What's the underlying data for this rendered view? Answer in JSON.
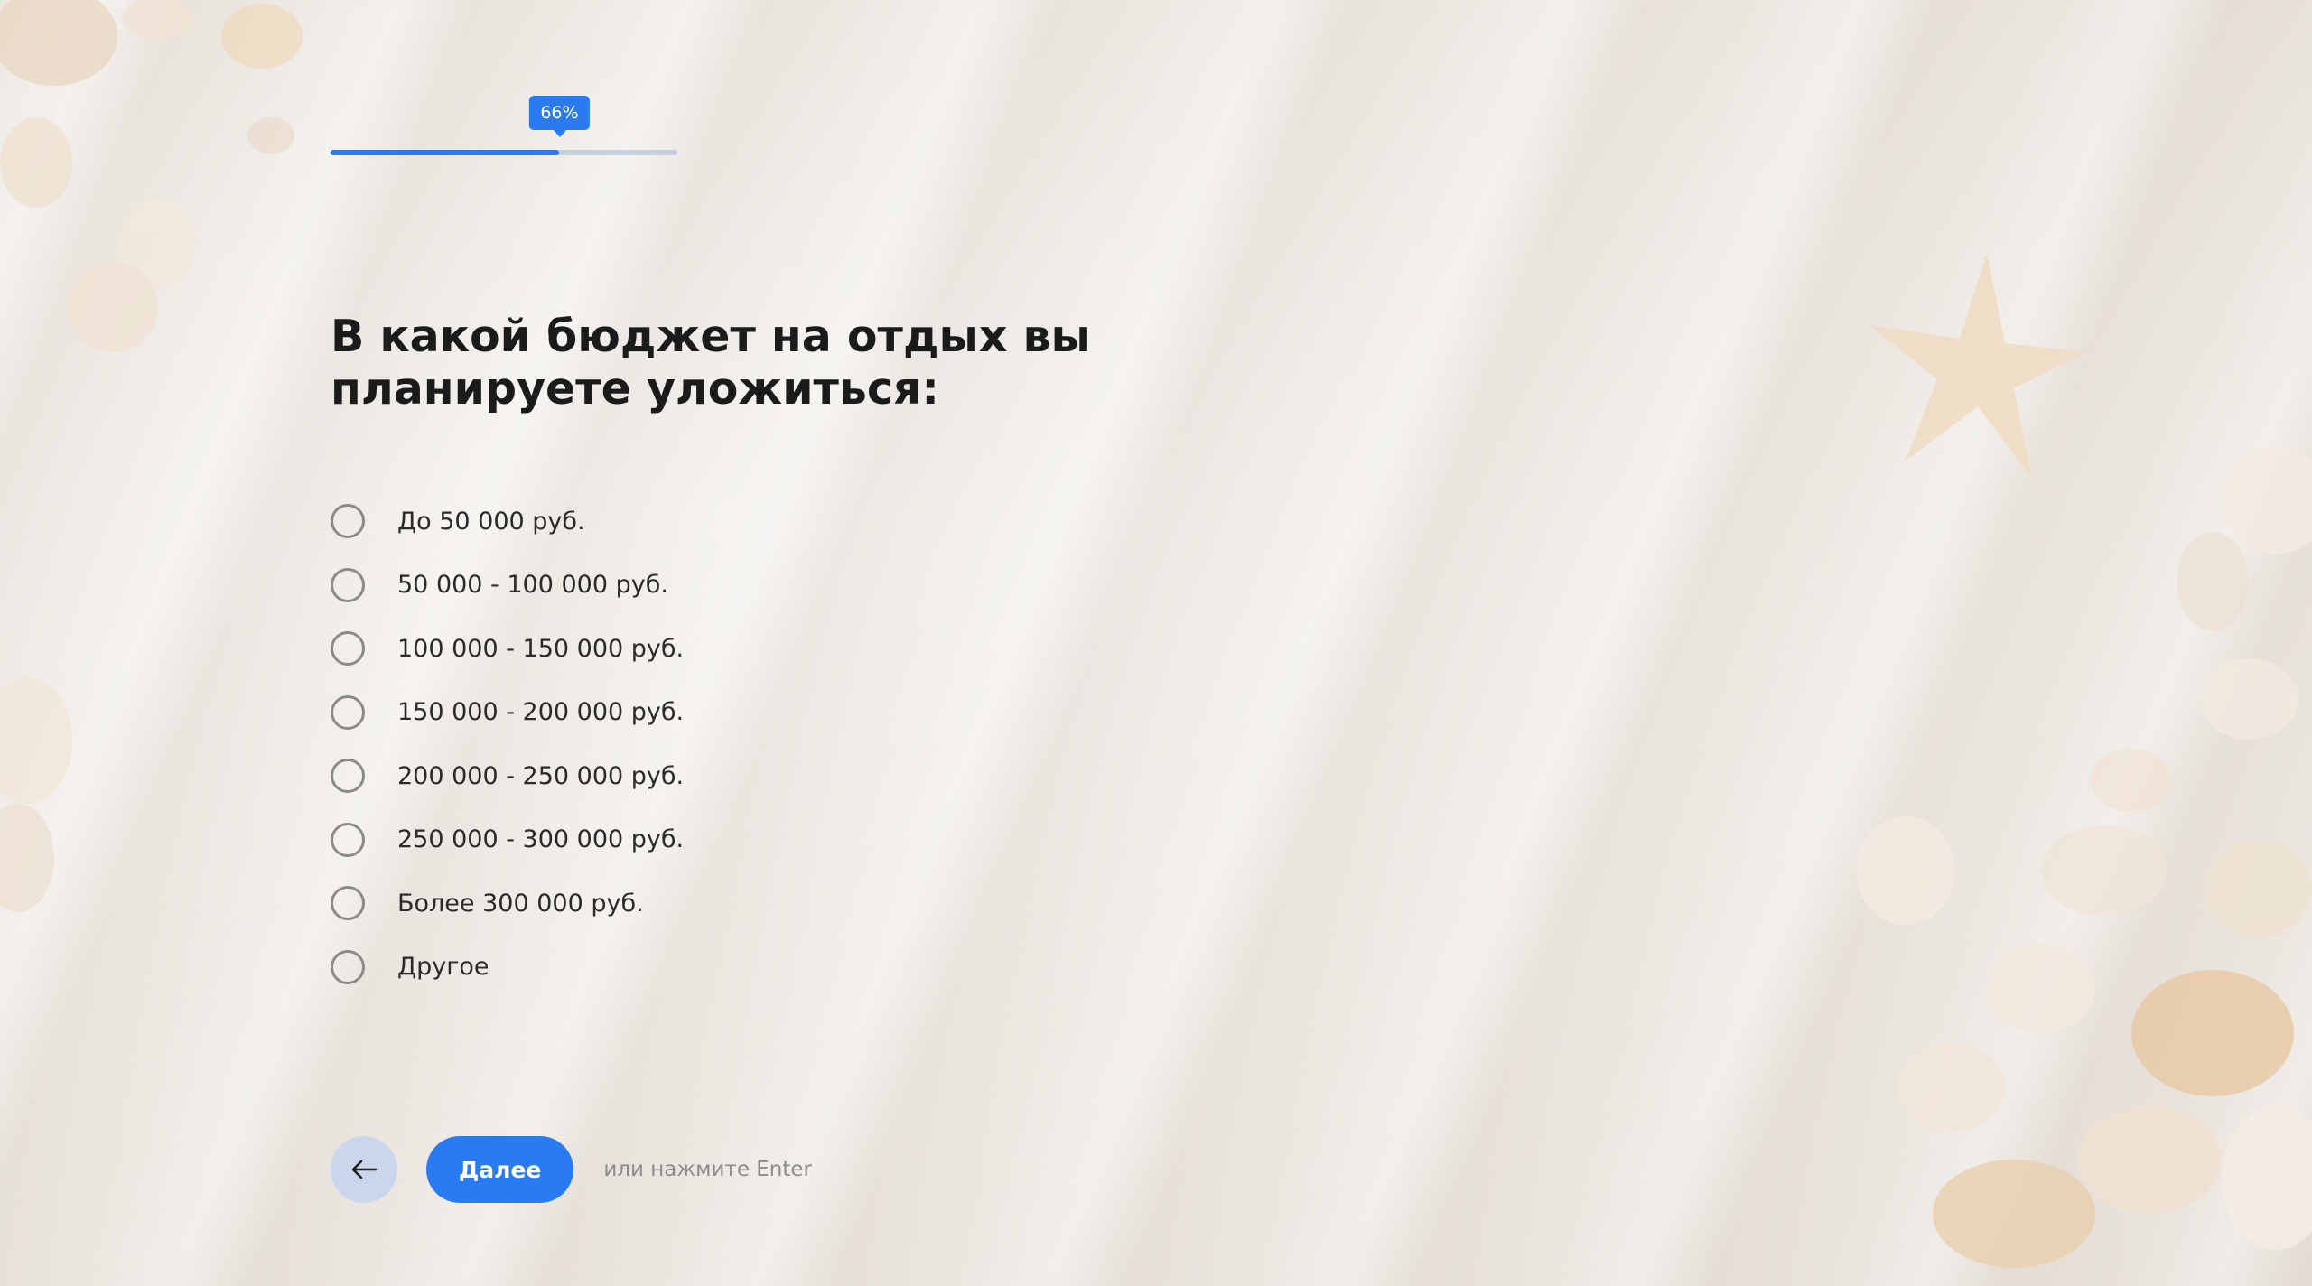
{
  "progress": {
    "percent_label": "66%",
    "value": 0.66
  },
  "question": {
    "title": "В какой бюджет на отдых вы планируете уложиться:"
  },
  "options": [
    {
      "label": "До 50 000 руб."
    },
    {
      "label": "50 000 - 100 000 руб."
    },
    {
      "label": "100 000 - 150 000 руб."
    },
    {
      "label": "150 000 - 200 000 руб."
    },
    {
      "label": "200 000 - 250 000 руб."
    },
    {
      "label": "250 000 - 300 000 руб."
    },
    {
      "label": "Более 300 000 руб."
    },
    {
      "label": "Другое"
    }
  ],
  "footer": {
    "back_icon": "arrow-left-icon",
    "next_label": "Далее",
    "hint": "или нажмите Enter"
  },
  "colors": {
    "accent": "#2b7bf0",
    "back_button_bg": "#c9d6ec",
    "radio_border": "#8a8a88"
  }
}
